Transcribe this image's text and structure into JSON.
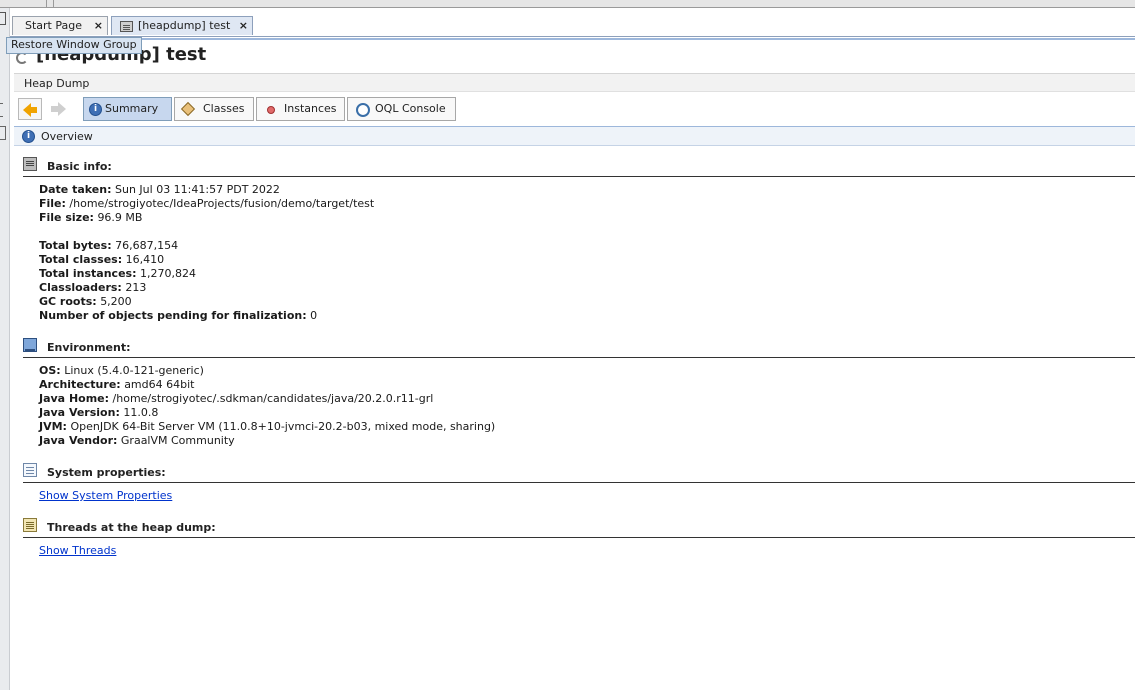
{
  "tabs": [
    {
      "label": "Start Page",
      "close": "×"
    },
    {
      "label": "[heapdump] test",
      "close": "×"
    }
  ],
  "tooltip": "Restore Window Group",
  "document": {
    "title": "[heapdump] test",
    "subtitle": "Heap Dump"
  },
  "toolbar": {
    "summary": "Summary",
    "classes": "Classes",
    "instances": "Instances",
    "oql": "OQL Console"
  },
  "overview": {
    "label": "Overview",
    "icon_glyph": "i"
  },
  "basic_info": {
    "title": "Basic info:",
    "rows": [
      {
        "label": "Date taken:",
        "value": "Sun Jul 03 11:41:57 PDT 2022"
      },
      {
        "label": "File:",
        "value": "/home/strogiyotec/IdeaProjects/fusion/demo/target/test"
      },
      {
        "label": "File size:",
        "value": "96.9 MB"
      },
      {
        "label": "Total bytes:",
        "value": "76,687,154"
      },
      {
        "label": "Total classes:",
        "value": "16,410"
      },
      {
        "label": "Total instances:",
        "value": "1,270,824"
      },
      {
        "label": "Classloaders:",
        "value": "213"
      },
      {
        "label": "GC roots:",
        "value": "5,200"
      },
      {
        "label": "Number of objects pending for finalization:",
        "value": "0"
      }
    ]
  },
  "environment": {
    "title": "Environment:",
    "rows": [
      {
        "label": "OS:",
        "value": "Linux (5.4.0-121-generic)"
      },
      {
        "label": "Architecture:",
        "value": "amd64 64bit"
      },
      {
        "label": "Java Home:",
        "value": "/home/strogiyotec/.sdkman/candidates/java/20.2.0.r11-grl"
      },
      {
        "label": "Java Version:",
        "value": "11.0.8"
      },
      {
        "label": "JVM:",
        "value": "OpenJDK 64-Bit Server VM (11.0.8+10-jvmci-20.2-b03, mixed mode, sharing)"
      },
      {
        "label": "Java Vendor:",
        "value": "GraalVM Community"
      }
    ]
  },
  "system_properties": {
    "title": "System properties:",
    "link": "Show System Properties"
  },
  "threads": {
    "title": "Threads at the heap dump:",
    "link": "Show Threads"
  }
}
